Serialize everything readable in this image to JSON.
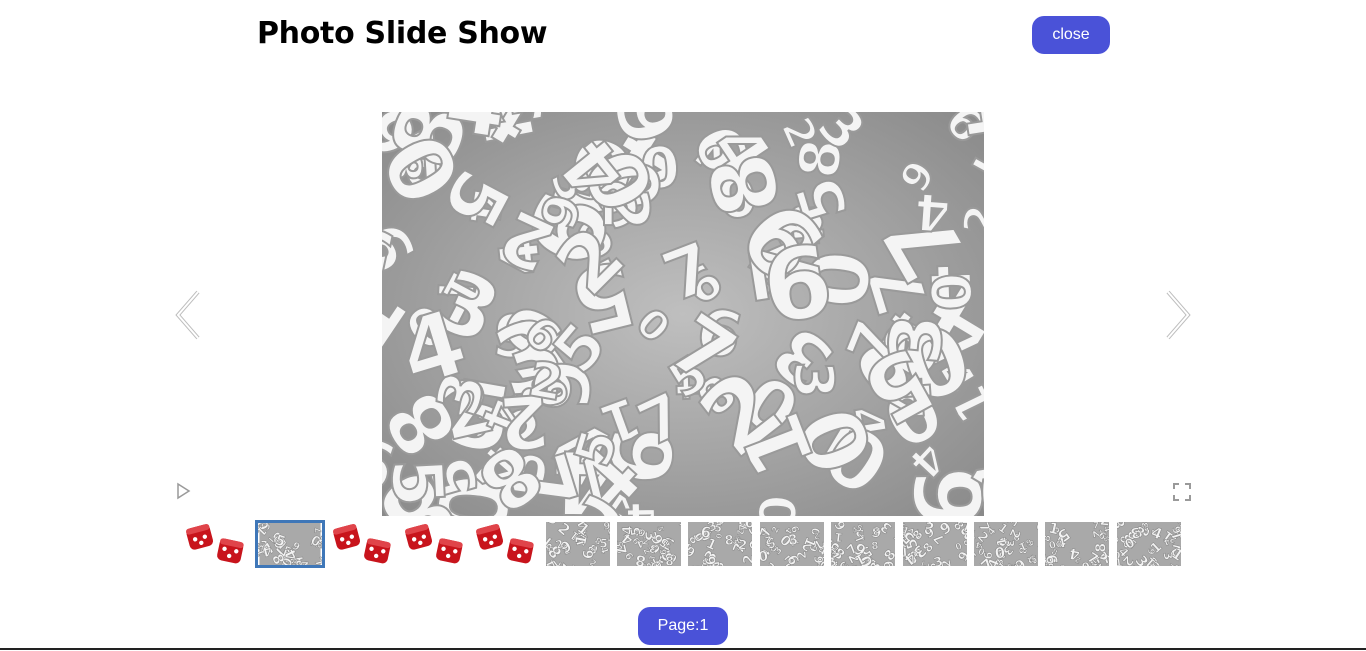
{
  "header": {
    "title": "Photo Slide Show",
    "close_label": "close"
  },
  "slideshow": {
    "main_image": "numbers-photo",
    "thumbnails": [
      {
        "image": "dice-icon",
        "active": false
      },
      {
        "image": "numbers-photo",
        "active": true
      },
      {
        "image": "dice-icon",
        "active": false
      },
      {
        "image": "dice-icon",
        "active": false
      },
      {
        "image": "dice-icon",
        "active": false
      },
      {
        "image": "numbers-photo",
        "active": false
      },
      {
        "image": "numbers-photo",
        "active": false
      },
      {
        "image": "numbers-photo",
        "active": false
      },
      {
        "image": "numbers-photo",
        "active": false
      },
      {
        "image": "numbers-photo",
        "active": false
      },
      {
        "image": "numbers-photo",
        "active": false
      },
      {
        "image": "numbers-photo",
        "active": false
      },
      {
        "image": "numbers-photo",
        "active": false
      },
      {
        "image": "numbers-photo",
        "active": false
      }
    ]
  },
  "footer": {
    "page_label": "Page:1"
  },
  "colors": {
    "accent": "#4a52d8",
    "active_thumb_border": "#3f77b8",
    "dice_red": "#c8141c"
  }
}
